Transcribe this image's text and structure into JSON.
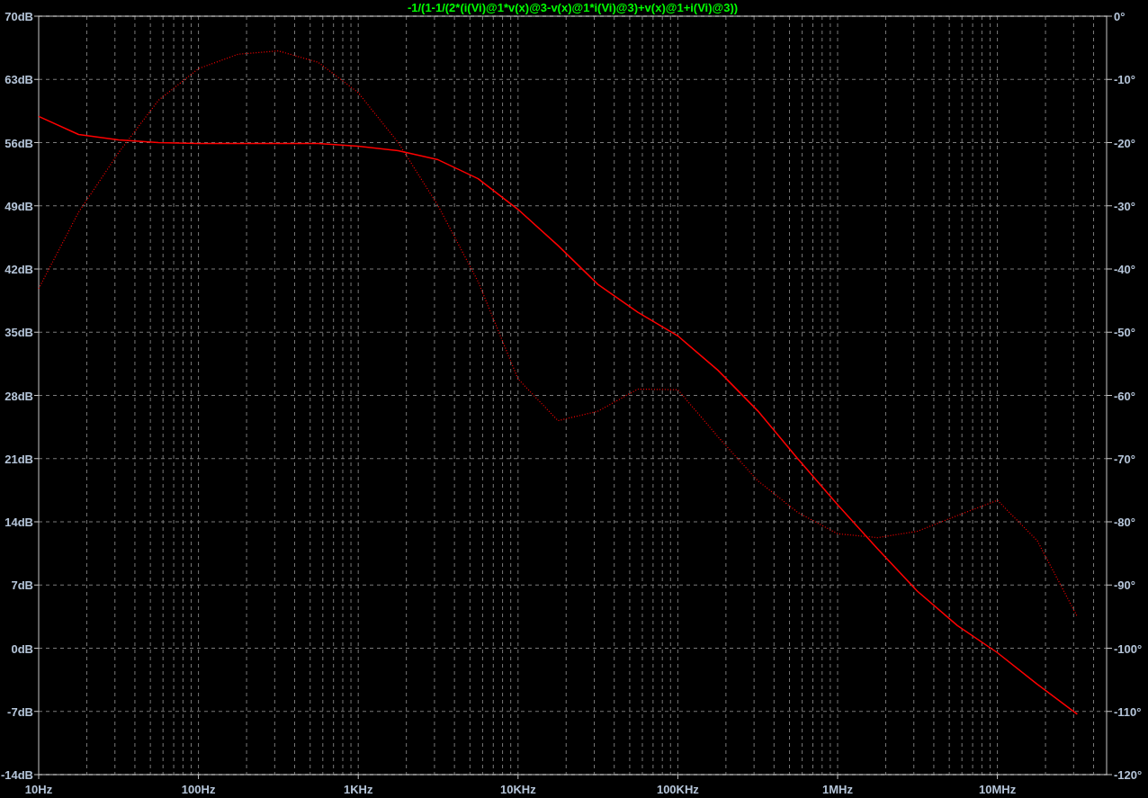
{
  "chart_data": {
    "type": "line",
    "title": "-1/(1-1/(2*(i(Vi)@1*v(x)@3-v(x)@1*i(Vi)@3)+v(x)@1+i(Vi)@3))",
    "categories": [
      "10Hz",
      null,
      null,
      null,
      "100Hz",
      null,
      null,
      null,
      "1KHz",
      null,
      null,
      null,
      "10KHz",
      null,
      null,
      null,
      "100KHz",
      null,
      null,
      null,
      "1MHz",
      null,
      null,
      null,
      "10MHz",
      null,
      null
    ],
    "series": [
      {
        "color": "#ff0000",
        "axis": "y",
        "line_style": "solid",
        "values": [
          58.9,
          56.9,
          56.3,
          56.0,
          55.9,
          55.9,
          55.9,
          55.9,
          55.6,
          55.1,
          54.1,
          52.0,
          48.6,
          44.6,
          40.3,
          37.2,
          34.6,
          30.8,
          26.3,
          21.0,
          15.9,
          11.0,
          6.3,
          2.5,
          -0.5,
          -4.0,
          -7.3
        ]
      },
      {
        "color": "#ff0000",
        "axis": "y2",
        "line_style": "dotted",
        "values": [
          -43.1,
          -31.0,
          -21.6,
          -13.3,
          -8.3,
          -6.0,
          -5.5,
          -7.3,
          -12.1,
          -20.0,
          -30.0,
          -42.0,
          -57.4,
          -64.0,
          -62.5,
          -59.0,
          -59.1,
          -66.5,
          -73.5,
          -78.5,
          -81.9,
          -82.5,
          -81.5,
          -79.0,
          -76.6,
          -83.0,
          -95.0
        ]
      }
    ],
    "grid": true,
    "ylim": [
      -14,
      70
    ],
    "yticks": [
      {
        "value": 70,
        "label": "70dB"
      },
      {
        "value": 63,
        "label": "63dB"
      },
      {
        "value": 56,
        "label": "56dB"
      },
      {
        "value": 49,
        "label": "49dB"
      },
      {
        "value": 42,
        "label": "42dB"
      },
      {
        "value": 35,
        "label": "35dB"
      },
      {
        "value": 28,
        "label": "28dB"
      },
      {
        "value": 21,
        "label": "21dB"
      },
      {
        "value": 14,
        "label": "14dB"
      },
      {
        "value": 7,
        "label": "7dB"
      },
      {
        "value": 0,
        "label": "0dB"
      },
      {
        "value": -7,
        "label": "-7dB"
      },
      {
        "value": -14,
        "label": "-14dB"
      }
    ],
    "y2lim": [
      -120,
      0
    ],
    "y2ticks": [
      {
        "value": 0,
        "label": "0°"
      },
      {
        "value": -10,
        "label": "-10°"
      },
      {
        "value": -20,
        "label": "-20°"
      },
      {
        "value": -30,
        "label": "-30°"
      },
      {
        "value": -40,
        "label": "-40°"
      },
      {
        "value": -50,
        "label": "-50°"
      },
      {
        "value": -60,
        "label": "-60°"
      },
      {
        "value": -70,
        "label": "-70°"
      },
      {
        "value": -80,
        "label": "-80°"
      },
      {
        "value": -90,
        "label": "-90°"
      },
      {
        "value": -100,
        "label": "-100°"
      },
      {
        "value": -110,
        "label": "-110°"
      },
      {
        "value": -120,
        "label": "-120°"
      }
    ]
  }
}
